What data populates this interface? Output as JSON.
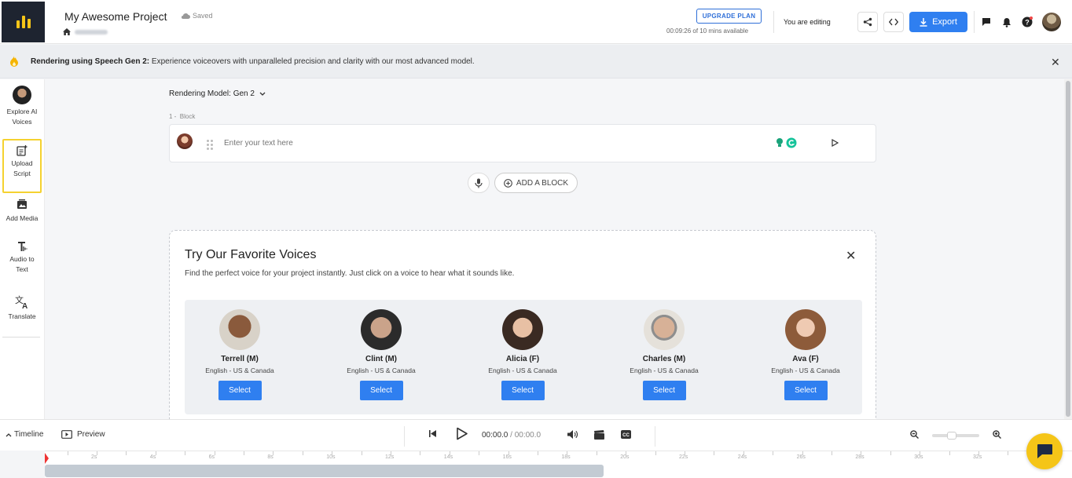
{
  "header": {
    "project_title": "My Awesome Project",
    "saved_label": "Saved",
    "upgrade_label": "UPGRADE PLAN",
    "time_available": "00:09:26 of 10 mins available",
    "editing_label": "You are editing",
    "export_label": "Export"
  },
  "banner": {
    "bold_text": "Rendering using Speech Gen 2:",
    "text": " Experience voiceovers with unparalleled precision and clarity with our most advanced model."
  },
  "sidebar": {
    "items": [
      {
        "label": "Explore AI Voices"
      },
      {
        "label": "Upload Script"
      },
      {
        "label": "Add Media"
      },
      {
        "label": "Audio to Text"
      },
      {
        "label": "Translate"
      }
    ]
  },
  "editor": {
    "model_label": "Rendering Model: Gen 2",
    "block_number": "1 -",
    "block_label": "Block",
    "placeholder": "Enter your text here",
    "add_block_label": "ADD A BLOCK"
  },
  "voices": {
    "title": "Try Our Favorite Voices",
    "subtitle": "Find the perfect voice for your project instantly. Just click on a voice to hear what it sounds like.",
    "items": [
      {
        "name": "Terrell (M)",
        "lang": "English - US & Canada",
        "button": "Select",
        "skin": "#8a5a3c",
        "bg": "#d8d2c8"
      },
      {
        "name": "Clint (M)",
        "lang": "English - US & Canada",
        "button": "Select",
        "skin": "#caa38a",
        "bg": "#2b2b2b"
      },
      {
        "name": "Alicia (F)",
        "lang": "English - US & Canada",
        "button": "Select",
        "skin": "#e8c0a4",
        "bg": "#3a2a22"
      },
      {
        "name": "Charles (M)",
        "lang": "English - US & Canada",
        "button": "Select",
        "skin": "#d7b197",
        "bg": "#e5e1da"
      },
      {
        "name": "Ava (F)",
        "lang": "English - US & Canada",
        "button": "Select",
        "skin": "#efcab2",
        "bg": "#8d5b3a"
      }
    ]
  },
  "transport": {
    "timeline_label": "Timeline",
    "preview_label": "Preview",
    "current_time": "00:00.0",
    "duration": "00:00.0"
  },
  "ruler": {
    "labels": [
      "2s",
      "4s",
      "6s",
      "8s",
      "10s",
      "12s",
      "14s",
      "16s",
      "18s",
      "20s",
      "22s",
      "24s",
      "26s",
      "28s",
      "30s",
      "32s"
    ]
  },
  "colors": {
    "accent": "#2f7ff0",
    "brand_yellow": "#f5c518",
    "logo_bg": "#1e2430"
  }
}
